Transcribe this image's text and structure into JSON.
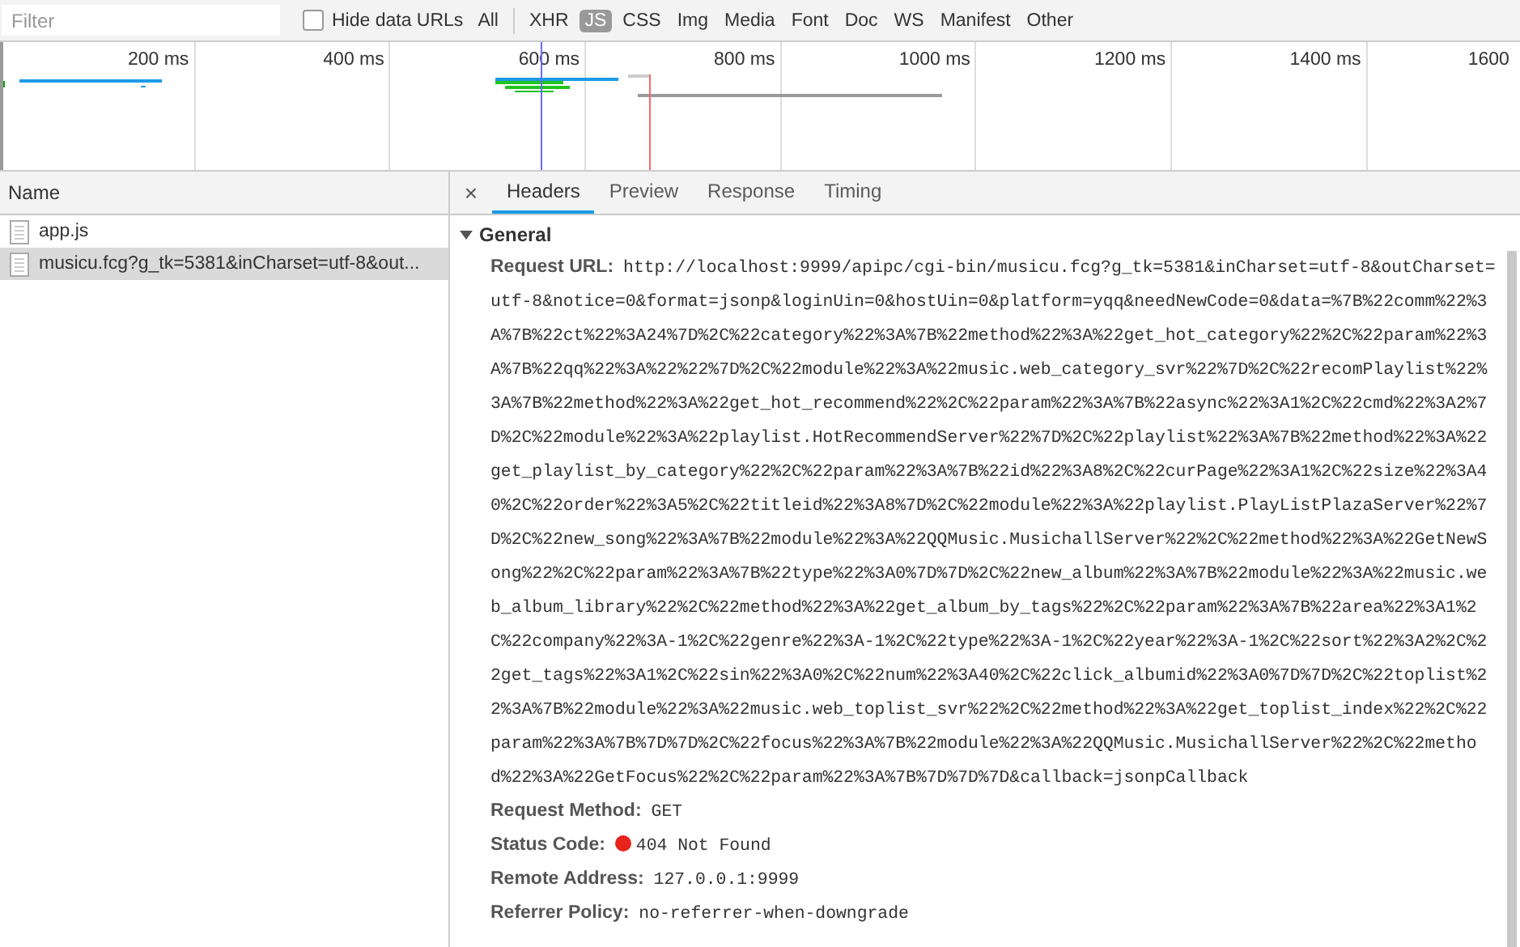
{
  "toolbar": {
    "filter": {
      "placeholder": "Filter"
    },
    "hide_data_urls": {
      "label": "Hide data URLs",
      "checked": false
    },
    "types": [
      {
        "label": "All",
        "selected": false
      },
      {
        "label": "XHR",
        "selected": false
      },
      {
        "label": "JS",
        "selected": true
      },
      {
        "label": "CSS",
        "selected": false
      },
      {
        "label": "Img",
        "selected": false
      },
      {
        "label": "Media",
        "selected": false
      },
      {
        "label": "Font",
        "selected": false
      },
      {
        "label": "Doc",
        "selected": false
      },
      {
        "label": "WS",
        "selected": false
      },
      {
        "label": "Manifest",
        "selected": false
      },
      {
        "label": "Other",
        "selected": false
      }
    ]
  },
  "timeline": {
    "ticks": [
      "200 ms",
      "400 ms",
      "600 ms",
      "800 ms",
      "1000 ms",
      "1200 ms",
      "1400 ms",
      "1600"
    ]
  },
  "requests": {
    "column": "Name",
    "items": [
      {
        "name": "app.js",
        "selected": false
      },
      {
        "name": "musicu.fcg?g_tk=5381&inCharset=utf-8&out...",
        "selected": true
      }
    ]
  },
  "details": {
    "close": "×",
    "tabs": [
      {
        "label": "Headers",
        "selected": true
      },
      {
        "label": "Preview",
        "selected": false
      },
      {
        "label": "Response",
        "selected": false
      },
      {
        "label": "Timing",
        "selected": false
      }
    ],
    "section": {
      "title": "General",
      "expanded": true,
      "fields": [
        {
          "label": "Request URL:",
          "value": "http://localhost:9999/apipc/cgi-bin/musicu.fcg?g_tk=5381&inCharset=utf-8&outCharset=utf-8&notice=0&format=jsonp&loginUin=0&hostUin=0&platform=yqq&needNewCode=0&data=%7B%22comm%22%3A%7B%22ct%22%3A24%7D%2C%22category%22%3A%7B%22method%22%3A%22get_hot_category%22%2C%22param%22%3A%7B%22qq%22%3A%22%22%7D%2C%22module%22%3A%22music.web_category_svr%22%7D%2C%22recomPlaylist%22%3A%7B%22method%22%3A%22get_hot_recommend%22%2C%22param%22%3A%7B%22async%22%3A1%2C%22cmd%22%3A2%7D%2C%22module%22%3A%22playlist.HotRecommendServer%22%7D%2C%22playlist%22%3A%7B%22method%22%3A%22get_playlist_by_category%22%2C%22param%22%3A%7B%22id%22%3A8%2C%22curPage%22%3A1%2C%22size%22%3A40%2C%22order%22%3A5%2C%22titleid%22%3A8%7D%2C%22module%22%3A%22playlist.PlayListPlazaServer%22%7D%2C%22new_song%22%3A%7B%22module%22%3A%22QQMusic.MusichallServer%22%2C%22method%22%3A%22GetNewSong%22%2C%22param%22%3A%7B%22type%22%3A0%7D%7D%2C%22new_album%22%3A%7B%22module%22%3A%22music.web_album_library%22%2C%22method%22%3A%22get_album_by_tags%22%2C%22param%22%3A%7B%22area%22%3A1%2C%22company%22%3A-1%2C%22genre%22%3A-1%2C%22type%22%3A-1%2C%22year%22%3A-1%2C%22sort%22%3A2%2C%22get_tags%22%3A1%2C%22sin%22%3A0%2C%22num%22%3A40%2C%22click_albumid%22%3A0%7D%7D%2C%22toplist%22%3A%7B%22module%22%3A%22music.web_toplist_svr%22%2C%22method%22%3A%22get_toplist_index%22%2C%22param%22%3A%7B%7D%7D%2C%22focus%22%3A%7B%22module%22%3A%22QQMusic.MusichallServer%22%2C%22method%22%3A%22GetFocus%22%2C%22param%22%3A%7B%7D%7D%7D&callback=jsonpCallback"
        },
        {
          "label": "Request Method:",
          "value": "GET"
        },
        {
          "label": "Status Code:",
          "value": "404 Not Found",
          "color": "#e8231b"
        },
        {
          "label": "Remote Address:",
          "value": "127.0.0.1:9999"
        },
        {
          "label": "Referrer Policy:",
          "value": "no-referrer-when-downgrade"
        }
      ]
    }
  }
}
